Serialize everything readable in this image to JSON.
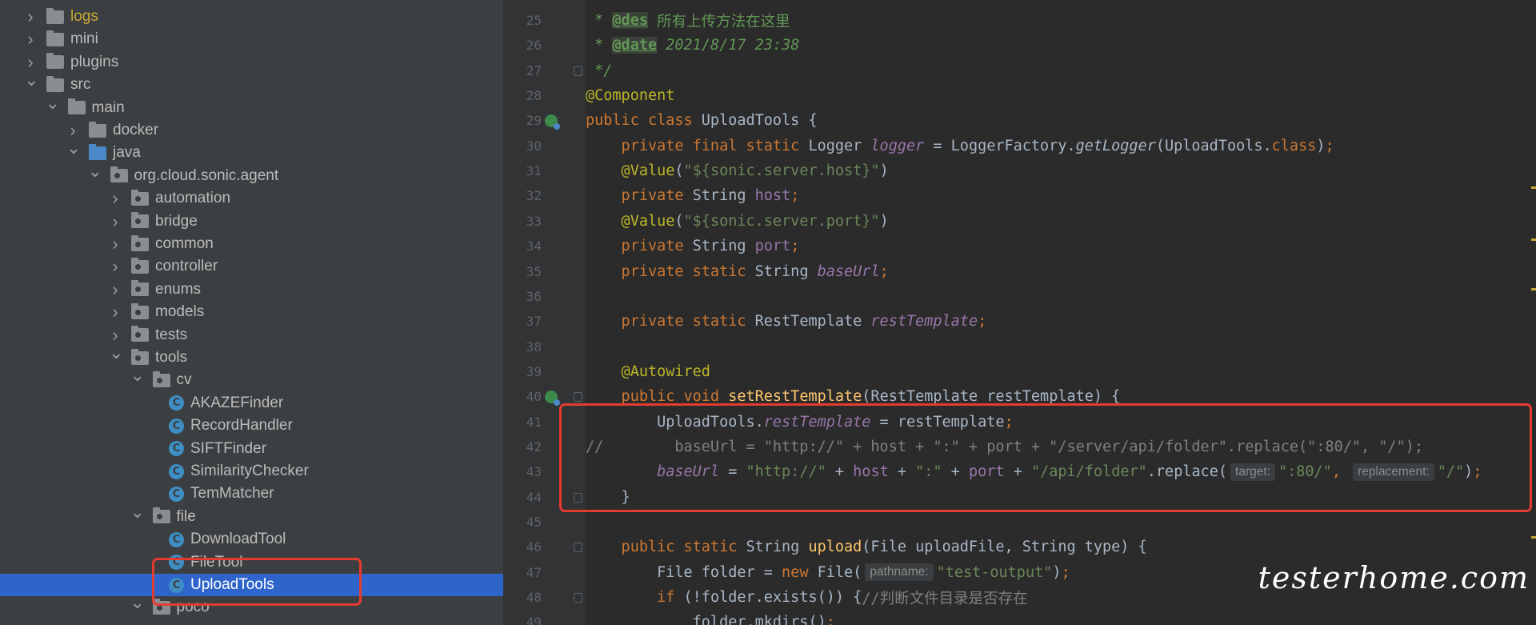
{
  "tree": {
    "rows": [
      {
        "label": "logs",
        "depth": 1,
        "type": "folder",
        "expanded": false,
        "yellow": true
      },
      {
        "label": "mini",
        "depth": 1,
        "type": "folder",
        "expanded": false
      },
      {
        "label": "plugins",
        "depth": 1,
        "type": "folder",
        "expanded": false
      },
      {
        "label": "src",
        "depth": 1,
        "type": "folder",
        "expanded": true
      },
      {
        "label": "main",
        "depth": 2,
        "type": "folder",
        "expanded": true
      },
      {
        "label": "docker",
        "depth": 3,
        "type": "folder",
        "expanded": false
      },
      {
        "label": "java",
        "depth": 3,
        "type": "folder-blue",
        "expanded": true
      },
      {
        "label": "org.cloud.sonic.agent",
        "depth": 4,
        "type": "package",
        "expanded": true
      },
      {
        "label": "automation",
        "depth": 5,
        "type": "package",
        "expanded": false
      },
      {
        "label": "bridge",
        "depth": 5,
        "type": "package",
        "expanded": false
      },
      {
        "label": "common",
        "depth": 5,
        "type": "package",
        "expanded": false
      },
      {
        "label": "controller",
        "depth": 5,
        "type": "package",
        "expanded": false
      },
      {
        "label": "enums",
        "depth": 5,
        "type": "package",
        "expanded": false
      },
      {
        "label": "models",
        "depth": 5,
        "type": "package",
        "expanded": false
      },
      {
        "label": "tests",
        "depth": 5,
        "type": "package",
        "expanded": false
      },
      {
        "label": "tools",
        "depth": 5,
        "type": "package",
        "expanded": true
      },
      {
        "label": "cv",
        "depth": 6,
        "type": "package",
        "expanded": true
      },
      {
        "label": "AKAZEFinder",
        "depth": 7,
        "type": "class"
      },
      {
        "label": "RecordHandler",
        "depth": 7,
        "type": "class"
      },
      {
        "label": "SIFTFinder",
        "depth": 7,
        "type": "class"
      },
      {
        "label": "SimilarityChecker",
        "depth": 7,
        "type": "class"
      },
      {
        "label": "TemMatcher",
        "depth": 7,
        "type": "class"
      },
      {
        "label": "file",
        "depth": 6,
        "type": "package",
        "expanded": true
      },
      {
        "label": "DownloadTool",
        "depth": 7,
        "type": "class"
      },
      {
        "label": "FileTool",
        "depth": 7,
        "type": "class"
      },
      {
        "label": "UploadTools",
        "depth": 7,
        "type": "class",
        "selected": true
      },
      {
        "label": "poco",
        "depth": 6,
        "type": "package",
        "expanded": true
      }
    ],
    "class_icon_letter": "C"
  },
  "editor": {
    "lines": [
      {
        "n": "25",
        "tokens": [
          [
            "doc",
            " * "
          ],
          [
            "doctag",
            "@des"
          ],
          [
            "docn",
            " 所有上传方法在这里"
          ]
        ]
      },
      {
        "n": "26",
        "tokens": [
          [
            "doc",
            " * "
          ],
          [
            "doctag",
            "@date"
          ],
          [
            "doc",
            " 2021/8/17 23:38"
          ]
        ]
      },
      {
        "n": "27",
        "tokens": [
          [
            "doc",
            " */"
          ]
        ],
        "fold": true
      },
      {
        "n": "28",
        "tokens": [
          [
            "ann",
            "@Component"
          ]
        ]
      },
      {
        "n": "29",
        "tokens": [
          [
            "kw",
            "public class "
          ],
          [
            "plain",
            "UploadTools {"
          ]
        ],
        "marker": true
      },
      {
        "n": "30",
        "tokens": [
          [
            "kw",
            "    private final static "
          ],
          [
            "plain",
            "Logger "
          ],
          [
            "fldi",
            "logger"
          ],
          [
            "plain",
            " = LoggerFactory."
          ],
          [
            "mi",
            "getLogger"
          ],
          [
            "plain",
            "(UploadTools."
          ],
          [
            "kw",
            "class"
          ],
          [
            "plain",
            ")"
          ],
          [
            "kw",
            ";"
          ]
        ]
      },
      {
        "n": "31",
        "tokens": [
          [
            "ann",
            "    @Value"
          ],
          [
            "plain",
            "("
          ],
          [
            "str",
            "\"${sonic.server.host}\""
          ],
          [
            "plain",
            ")"
          ]
        ]
      },
      {
        "n": "32",
        "tokens": [
          [
            "kw",
            "    private "
          ],
          [
            "plain",
            "String "
          ],
          [
            "fld",
            "host"
          ],
          [
            "kw",
            ";"
          ]
        ]
      },
      {
        "n": "33",
        "tokens": [
          [
            "ann",
            "    @Value"
          ],
          [
            "plain",
            "("
          ],
          [
            "str",
            "\"${sonic.server.port}\""
          ],
          [
            "plain",
            ")"
          ]
        ]
      },
      {
        "n": "34",
        "tokens": [
          [
            "kw",
            "    private "
          ],
          [
            "plain",
            "String "
          ],
          [
            "fld",
            "port"
          ],
          [
            "kw",
            ";"
          ]
        ]
      },
      {
        "n": "35",
        "tokens": [
          [
            "kw",
            "    private static "
          ],
          [
            "plain",
            "String "
          ],
          [
            "fldi",
            "baseUrl"
          ],
          [
            "kw",
            ";"
          ]
        ]
      },
      {
        "n": "36",
        "tokens": []
      },
      {
        "n": "37",
        "tokens": [
          [
            "kw",
            "    private static "
          ],
          [
            "plain",
            "RestTemplate "
          ],
          [
            "fldi",
            "restTemplate"
          ],
          [
            "kw",
            ";"
          ]
        ]
      },
      {
        "n": "38",
        "tokens": []
      },
      {
        "n": "39",
        "tokens": [
          [
            "ann",
            "    @Autowired"
          ]
        ]
      },
      {
        "n": "40",
        "tokens": [
          [
            "kw",
            "    public void "
          ],
          [
            "fn",
            "setRestTemplate"
          ],
          [
            "plain",
            "(RestTemplate restTemplate) {"
          ]
        ],
        "marker": true,
        "fold": true
      },
      {
        "n": "41",
        "tokens": [
          [
            "plain",
            "        UploadTools."
          ],
          [
            "fldi",
            "restTemplate"
          ],
          [
            "plain",
            " = restTemplate"
          ],
          [
            "kw",
            ";"
          ]
        ]
      },
      {
        "n": "42",
        "tokens": [
          [
            "cmt",
            "//        baseUrl = \"http://\" + host + \":\" + port + \"/server/api/folder\".replace(\":80/\", \"/\");"
          ]
        ]
      },
      {
        "n": "43",
        "tokens": [
          [
            "fldi",
            "        baseUrl"
          ],
          [
            "plain",
            " = "
          ],
          [
            "str",
            "\"http://\""
          ],
          [
            "plain",
            " + "
          ],
          [
            "fld",
            "host"
          ],
          [
            "plain",
            " + "
          ],
          [
            "str",
            "\":\""
          ],
          [
            "plain",
            " + "
          ],
          [
            "fld",
            "port"
          ],
          [
            "plain",
            " + "
          ],
          [
            "str",
            "\"/api/folder\""
          ],
          [
            "plain",
            ".replace("
          ],
          [
            "hint",
            "target:"
          ],
          [
            "str",
            "\":80/\""
          ],
          [
            "kw",
            ", "
          ],
          [
            "hint",
            "replacement:"
          ],
          [
            "str",
            "\"/\""
          ],
          [
            "plain",
            ")"
          ],
          [
            "kw",
            ";"
          ]
        ]
      },
      {
        "n": "44",
        "tokens": [
          [
            "plain",
            "    }"
          ]
        ],
        "fold": true
      },
      {
        "n": "45",
        "tokens": []
      },
      {
        "n": "46",
        "tokens": [
          [
            "kw",
            "    public static "
          ],
          [
            "plain",
            "String "
          ],
          [
            "fn",
            "upload"
          ],
          [
            "plain",
            "(File uploadFile, String type) {"
          ]
        ],
        "fold": true
      },
      {
        "n": "47",
        "tokens": [
          [
            "plain",
            "        File folder = "
          ],
          [
            "kw",
            "new "
          ],
          [
            "plain",
            "File("
          ],
          [
            "hint",
            "pathname:"
          ],
          [
            "str",
            "\"test-output\""
          ],
          [
            "plain",
            ")"
          ],
          [
            "kw",
            ";"
          ]
        ]
      },
      {
        "n": "48",
        "tokens": [
          [
            "kw",
            "        if "
          ],
          [
            "plain",
            "(!folder.exists()) {"
          ],
          [
            "cmt",
            "//判断文件目录是否存在"
          ]
        ],
        "fold": true
      },
      {
        "n": "49",
        "tokens": [
          [
            "plain",
            "            folder.mkdirs()"
          ],
          [
            "kw",
            ";"
          ]
        ]
      }
    ]
  },
  "watermark": "testerhome.com"
}
